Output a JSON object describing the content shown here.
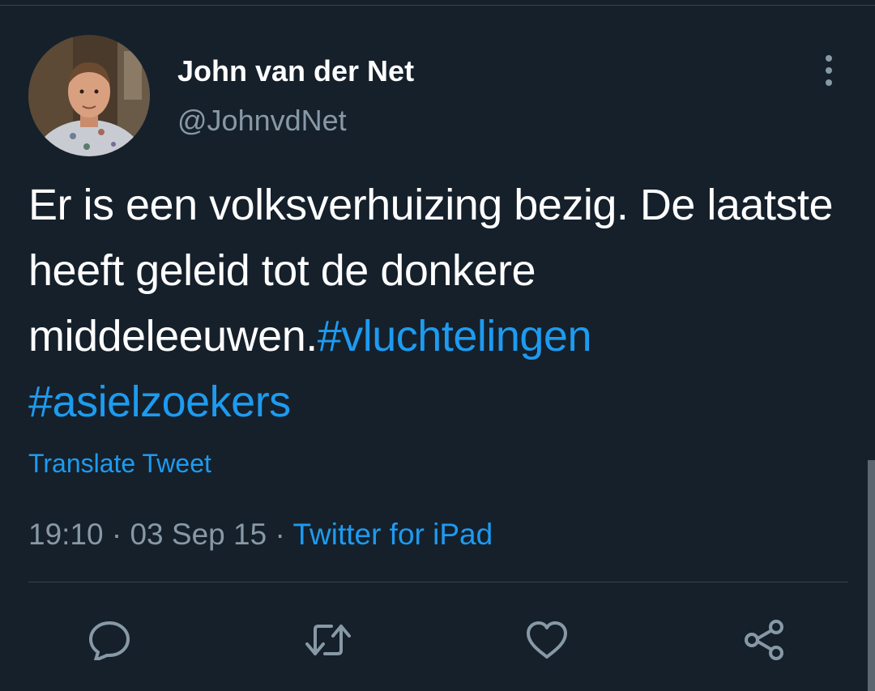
{
  "tweet": {
    "author": {
      "display_name": "John van der Net",
      "handle": "@JohnvdNet"
    },
    "text_parts": [
      {
        "text": "Er is een volksverhuizing bezig. De laatste heeft geleid tot de donkere middeleeuwen.",
        "type": "plain"
      },
      {
        "text": "#vluchtelingen",
        "type": "hashtag"
      },
      {
        "text": "#asielzoekers",
        "type": "hashtag"
      }
    ],
    "translate_label": "Translate Tweet",
    "time": "19:10",
    "date": "03 Sep 15",
    "separator": "·",
    "source": "Twitter for iPad"
  },
  "actions": [
    {
      "icon": "reply-icon"
    },
    {
      "icon": "retweet-icon"
    },
    {
      "icon": "like-icon"
    },
    {
      "icon": "share-icon"
    }
  ],
  "colors": {
    "background": "#15202b",
    "accent": "#1d9bf0",
    "secondary_text": "#8899a6",
    "divider": "#38444d"
  }
}
